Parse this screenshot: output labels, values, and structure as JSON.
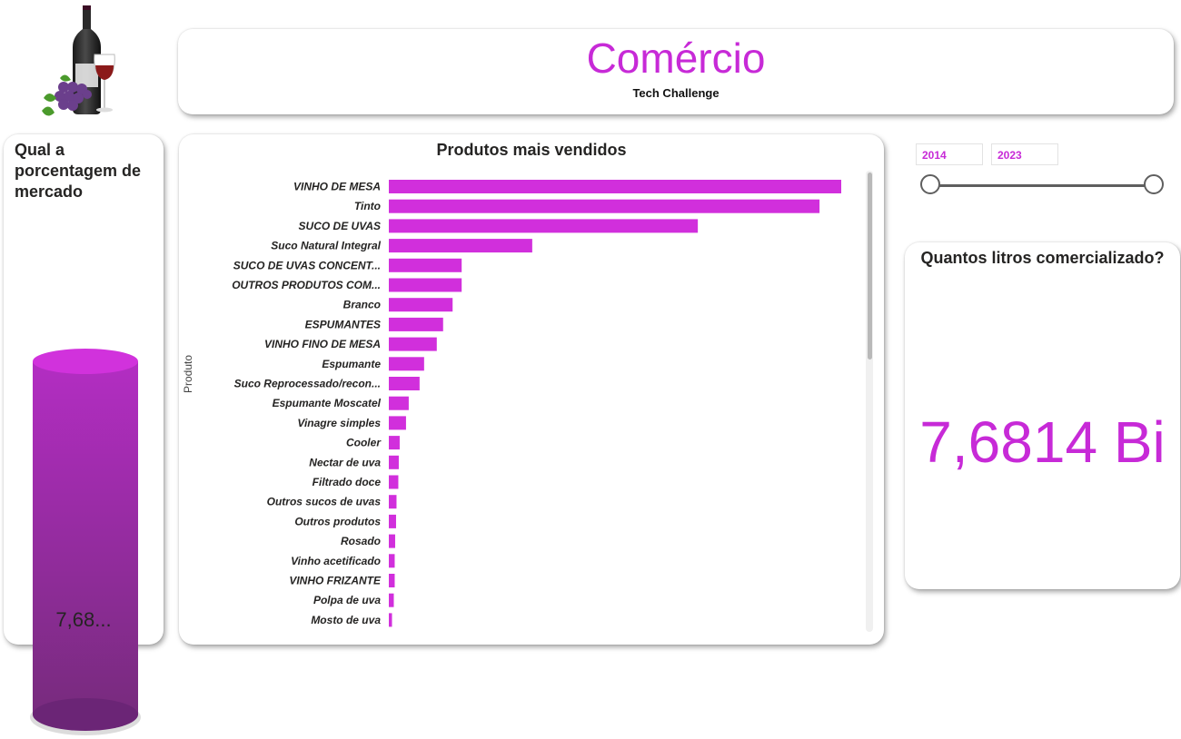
{
  "header": {
    "title": "Comércio",
    "subtitle": "Tech Challenge"
  },
  "market_share": {
    "question": "Qual a porcentagem de mercado",
    "value": "7,68..."
  },
  "slicer": {
    "start": "2014",
    "end": "2023"
  },
  "liters": {
    "question": "Quantos litros comercializado?",
    "value": "7,6814 Bi"
  },
  "colors": {
    "accent": "#c72ad7",
    "bar": "#d12fdc",
    "cylinder_top": "#d132dc",
    "cylinder_bottom": "#6b2576"
  },
  "icons": {
    "logo": "wine-bottle-glass-grapes-icon"
  },
  "chart_data": {
    "type": "bar",
    "orientation": "horizontal",
    "title": "Produtos mais vendidos",
    "ylabel": "Produto",
    "xlabel": "",
    "grid": false,
    "legend": "none",
    "categories": [
      "VINHO DE MESA",
      "Tinto",
      "SUCO DE UVAS",
      "Suco Natural Integral",
      "SUCO DE UVAS CONCENT...",
      "OUTROS PRODUTOS COM...",
      "Branco",
      "ESPUMANTES",
      "VINHO FINO DE MESA",
      "Espumante",
      "Suco Reprocessado/recon...",
      "Espumante Moscatel",
      "Vinagre simples",
      "Cooler",
      "Nectar de uva",
      "Filtrado doce",
      "Outros sucos de uvas",
      "Outros produtos",
      "Rosado",
      "Vinho acetificado",
      "VINHO FRIZANTE",
      "Polpa de uva",
      "Mosto de uva"
    ],
    "values": [
      100,
      95.2,
      68.3,
      31.7,
      16.1,
      16.1,
      14.1,
      12.0,
      10.6,
      7.8,
      6.8,
      4.4,
      3.8,
      2.4,
      2.2,
      2.1,
      1.7,
      1.6,
      1.4,
      1.3,
      1.3,
      1.1,
      0.7
    ],
    "xlim": [
      0,
      100
    ]
  }
}
